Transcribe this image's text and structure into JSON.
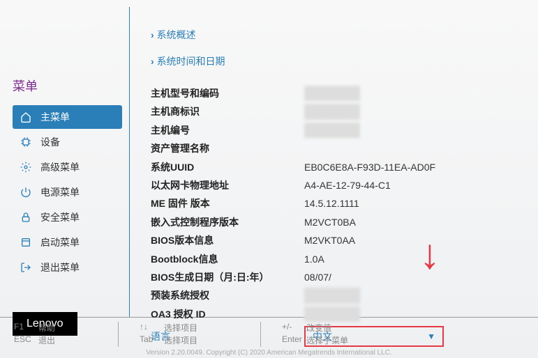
{
  "sidebar": {
    "title": "菜单",
    "items": [
      {
        "label": "主菜单",
        "icon": "home"
      },
      {
        "label": "设备",
        "icon": "chip"
      },
      {
        "label": "高级菜单",
        "icon": "gear"
      },
      {
        "label": "电源菜单",
        "icon": "power"
      },
      {
        "label": "安全菜单",
        "icon": "lock"
      },
      {
        "label": "启动菜单",
        "icon": "boot"
      },
      {
        "label": "退出菜单",
        "icon": "exit"
      }
    ],
    "logo": "Lenovo"
  },
  "nav": {
    "overview": "系统概述",
    "datetime": "系统时间和日期"
  },
  "info": {
    "rows": [
      {
        "label": "主机型号和编码",
        "value": ""
      },
      {
        "label": "主机商标识",
        "value": ""
      },
      {
        "label": "主机编号",
        "value": ""
      },
      {
        "label": "资产管理名称",
        "value": ""
      },
      {
        "label": "系统UUID",
        "value": "EB0C6E8A-F93D-11EA-AD0F"
      },
      {
        "label": "以太网卡物理地址",
        "value": "A4-AE-12-79-44-C1"
      },
      {
        "label": "ME 固件 版本",
        "value": "14.5.12.1111"
      },
      {
        "label": "嵌入式控制程序版本",
        "value": "M2VCT0BA"
      },
      {
        "label": "BIOS版本信息",
        "value": "M2VKT0AA"
      },
      {
        "label": "Bootblock信息",
        "value": "1.0A"
      },
      {
        "label": "BIOS生成日期（月:日:年）",
        "value": "08/07/"
      },
      {
        "label": "预装系统授权",
        "value": ""
      },
      {
        "label": "OA3 授权 ID",
        "value": ""
      }
    ],
    "language_label": "语言",
    "language_value": "中文"
  },
  "footer": {
    "f1_key": "F1",
    "f1_label": "帮助",
    "esc_key": "ESC",
    "esc_label": "退出",
    "arrows_key": "↑↓",
    "arrows_label": "选择项目",
    "tab_key": "Tab",
    "tab_label": "选择项目",
    "pm_key": "+/-",
    "pm_label": "改变值",
    "enter_key": "Enter",
    "enter_label": "选择子菜单",
    "copyright": "Version 2.20.0049. Copyright (C) 2020 American Megatrends International LLC."
  }
}
